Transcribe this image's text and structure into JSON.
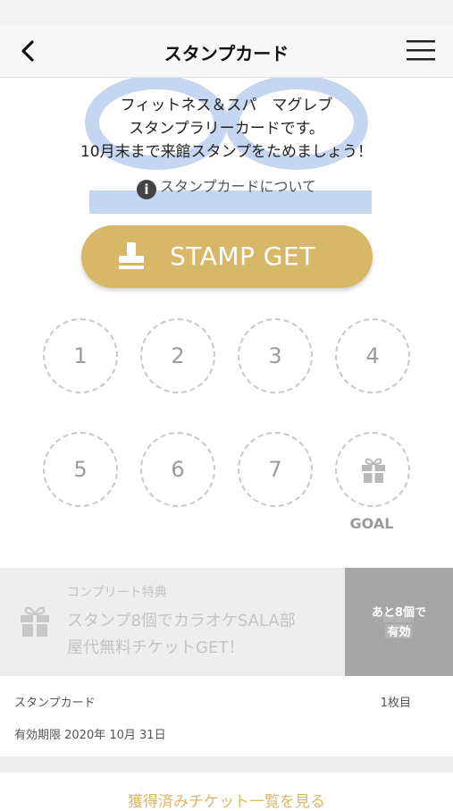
{
  "header": {
    "title": "スタンプカード",
    "back_icon": "chevron-left-icon",
    "menu_icon": "hamburger-menu-icon"
  },
  "intro": {
    "line1": "フィットネス＆スパ　マグレブ",
    "line2": "スタンプラリーカードです。",
    "line3": "10月末まで来館スタンプをためましょう！",
    "about_icon": "info-icon",
    "about_text": "スタンプカードについて"
  },
  "stamp_button": {
    "label": "STAMP GET",
    "icon": "stamp-icon",
    "color": "#d9b769"
  },
  "stamps": {
    "slots": [
      "1",
      "2",
      "3",
      "4",
      "5",
      "6",
      "7"
    ],
    "goal_icon": "gift-icon",
    "goal_label": "GOAL"
  },
  "complete_reward": {
    "title": "コンプリート特典",
    "line1": "スタンプ8個でカラオケSALA部",
    "line2": "屋代無料チケットGET！",
    "remaining_line1": "あと8個で",
    "remaining_line2": "有効",
    "icon": "gift-icon"
  },
  "card_info": {
    "name": "スタンプカード",
    "count": "1枚目",
    "expiry": "有効期限 2020年 10月 31日"
  },
  "ticket_link": {
    "label": "獲得済みチケット一覧を見る"
  }
}
